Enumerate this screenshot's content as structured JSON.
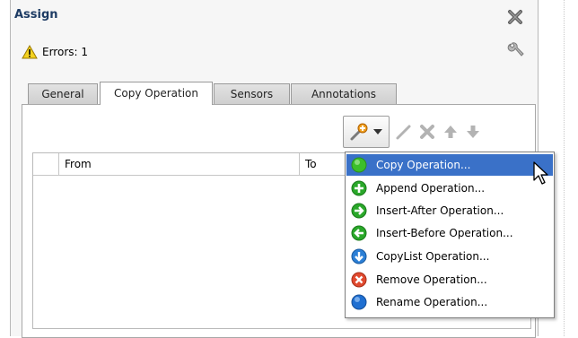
{
  "dialog": {
    "title": "Assign",
    "errors_label": "Errors: 1"
  },
  "tabs": [
    {
      "label": "General"
    },
    {
      "label": "Copy Operation",
      "active": true
    },
    {
      "label": "Sensors"
    },
    {
      "label": "Annotations"
    }
  ],
  "table": {
    "columns": [
      "",
      "From",
      "To"
    ]
  },
  "menu": {
    "items": [
      {
        "label": "Copy Operation...",
        "icon": "green-dot-icon",
        "selected": true
      },
      {
        "label": "Append Operation...",
        "icon": "plus-green-icon"
      },
      {
        "label": "Insert-After Operation...",
        "icon": "arrow-right-green-icon"
      },
      {
        "label": "Insert-Before Operation...",
        "icon": "arrow-left-green-icon"
      },
      {
        "label": "CopyList Operation...",
        "icon": "arrow-down-blue-icon"
      },
      {
        "label": "Remove Operation...",
        "icon": "x-red-icon"
      },
      {
        "label": "Rename Operation...",
        "icon": "blue-dot-icon"
      }
    ]
  },
  "colors": {
    "title": "#1e3c64",
    "selection": "#3a71c8"
  }
}
